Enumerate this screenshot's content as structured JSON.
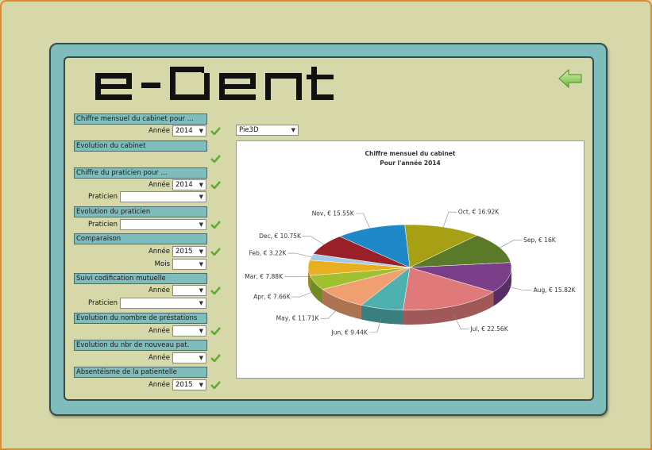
{
  "logo_text": "e-Dent",
  "filters": {
    "monthly_cabinet": {
      "title": "Chiffre mensuel du cabinet pour ...",
      "year_label": "Année",
      "year": "2014"
    },
    "cabinet_evolution": {
      "title": "Evolution du cabinet"
    },
    "practitioner_revenue": {
      "title": "Chiffre du praticien pour ...",
      "year_label": "Année",
      "year": "2014",
      "practitioner_label": "Praticien",
      "practitioner": ""
    },
    "practitioner_evolution": {
      "title": "Evolution du praticien",
      "practitioner_label": "Praticien",
      "practitioner": ""
    },
    "comparison": {
      "title": "Comparaison",
      "year_label": "Année",
      "year": "2015",
      "month_label": "Mois",
      "month": ""
    },
    "mutual_coding": {
      "title": "Suivi codification mutuelle",
      "year_label": "Année",
      "year": "",
      "practitioner_label": "Praticien",
      "practitioner": ""
    },
    "services_count": {
      "title": "Evolution du nombre de préstations",
      "year_label": "Année",
      "year": ""
    },
    "new_patients": {
      "title": "Evolution du nbr de nouveau pat.",
      "year_label": "Année",
      "year": ""
    },
    "absenteeism": {
      "title": "Absentéisme de la patientelle",
      "year_label": "Année",
      "year": "2015"
    }
  },
  "chart_type_select": "Pie3D",
  "chart_data": {
    "type": "pie",
    "title": "Chiffre mensuel du cabinet",
    "subtitle": "Pour l'année 2014",
    "slices": [
      {
        "label": "Oct, € 16.92K",
        "value": 16.92,
        "color": "#a8a014"
      },
      {
        "label": "Sep, € 16K",
        "value": 16.0,
        "color": "#5a7a2a"
      },
      {
        "label": "Aug, € 15.82K",
        "value": 15.82,
        "color": "#7b3f8a"
      },
      {
        "label": "Jul, € 22.56K",
        "value": 22.56,
        "color": "#e07a7a"
      },
      {
        "label": "Jun, € 9.44K",
        "value": 9.44,
        "color": "#4fb0b0"
      },
      {
        "label": "May, € 11.71K",
        "value": 11.71,
        "color": "#f0a070"
      },
      {
        "label": "Apr, € 7.66K",
        "value": 7.66,
        "color": "#a0c030"
      },
      {
        "label": "Mar, € 7.88K",
        "value": 7.88,
        "color": "#e8b020"
      },
      {
        "label": "Feb, € 3.22K",
        "value": 3.22,
        "color": "#a8c8e8"
      },
      {
        "label": "Dec, € 10.75K",
        "value": 10.75,
        "color": "#9a2028"
      },
      {
        "label": "Nov, € 15.55K",
        "value": 15.55,
        "color": "#1f88c8"
      }
    ]
  }
}
